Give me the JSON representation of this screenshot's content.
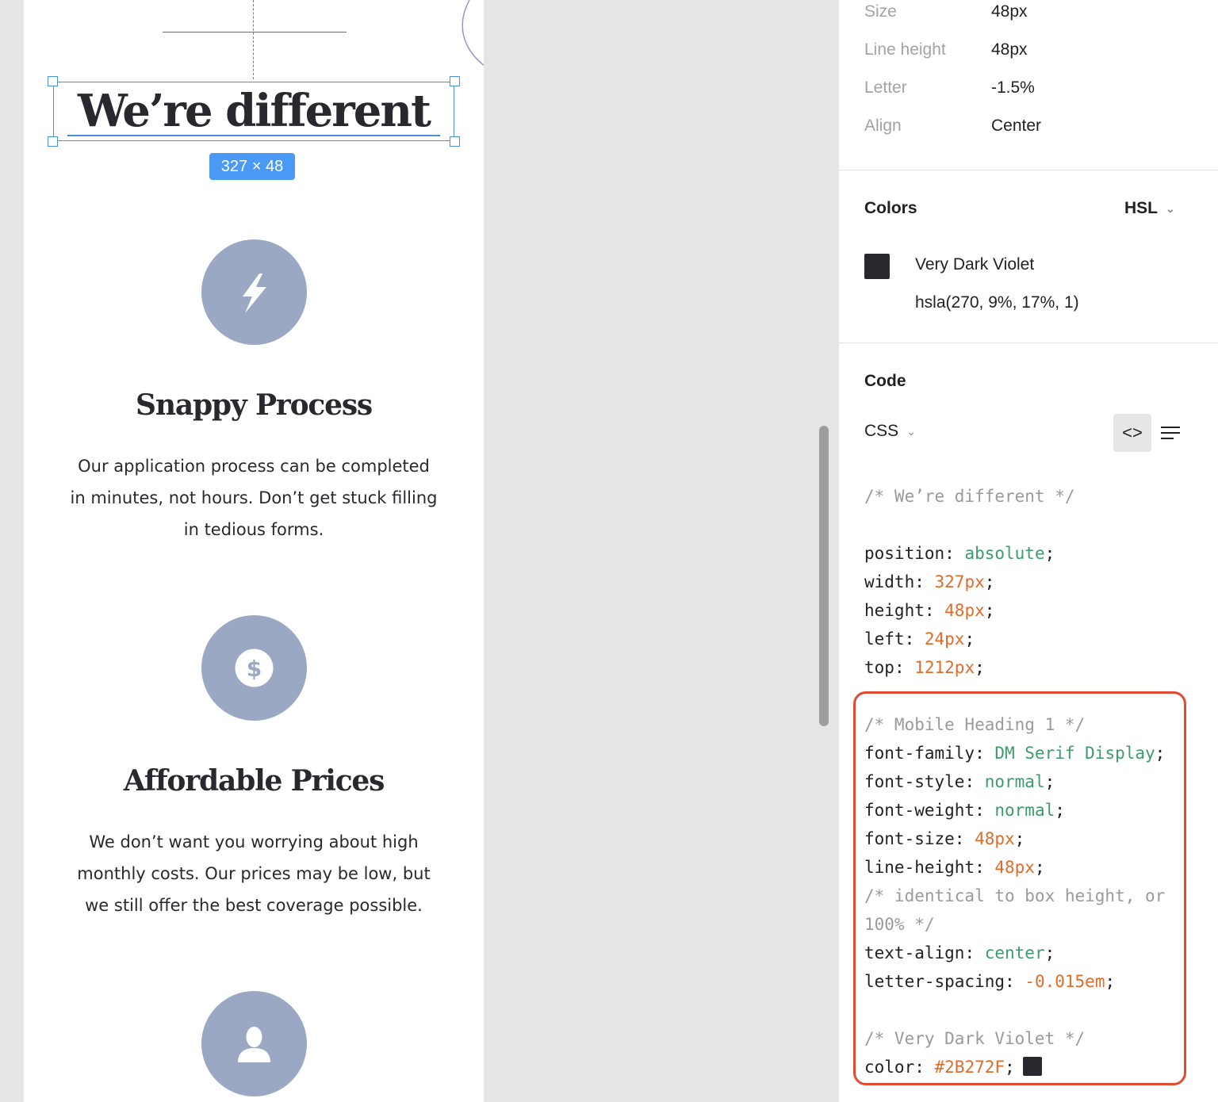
{
  "canvas": {
    "heading": "We’re different",
    "size_badge": "327 × 48",
    "features": [
      {
        "icon": "lightning-icon",
        "title": "Snappy Process",
        "lines": [
          "Our application process can be completed",
          "in minutes, not hours. Don’t get stuck filling",
          "in tedious forms."
        ]
      },
      {
        "icon": "dollar-icon",
        "title": "Affordable Prices",
        "lines": [
          "We don’t want you worrying about high",
          "monthly costs. Our prices may be low, but",
          "we still offer the best coverage possible."
        ]
      },
      {
        "icon": "person-icon"
      }
    ],
    "colors": {
      "artboard": "#ffffff",
      "canvas_bg": "#e5e5e5",
      "icon_circle": "#9aa8c4",
      "selection": "#4a90e2"
    }
  },
  "inspector": {
    "typography": [
      {
        "label": "Size",
        "value": "48px"
      },
      {
        "label": "Line height",
        "value": "48px"
      },
      {
        "label": "Letter",
        "value": "-1.5%"
      },
      {
        "label": "Align",
        "value": "Center"
      }
    ],
    "colors_section": {
      "title": "Colors",
      "mode": "HSL",
      "swatch_name": "Very Dark Violet",
      "swatch_value": "hsla(270, 9%, 17%, 1)",
      "swatch_color": "#2B272F"
    },
    "code_section": {
      "title": "Code",
      "language": "CSS",
      "lines": {
        "comment_name": "/* We’re different */",
        "position_prop": "position",
        "position_val": "absolute",
        "width_prop": "width",
        "width_val": "327px",
        "height_prop": "height",
        "height_val": "48px",
        "left_prop": "left",
        "left_val": "24px",
        "top_prop": "top",
        "top_val": "1212px",
        "comment_style": "/* Mobile Heading 1 */",
        "font_family_prop": "font-family",
        "font_family_val": "DM Serif Display",
        "font_style_prop": "font-style",
        "font_style_val": "normal",
        "font_weight_prop": "font-weight",
        "font_weight_val": "normal",
        "font_size_prop": "font-size",
        "font_size_val": "48px",
        "line_height_prop": "line-height",
        "line_height_val": "48px",
        "comment_lh_1": "/* identical to box height, or",
        "comment_lh_2": "100% */",
        "text_align_prop": "text-align",
        "text_align_val": "center",
        "letter_spacing_prop": "letter-spacing",
        "letter_spacing_val": "-0.015em",
        "comment_color": "/* Very Dark Violet */",
        "color_prop": "color",
        "color_val": "#2B272F"
      }
    }
  }
}
